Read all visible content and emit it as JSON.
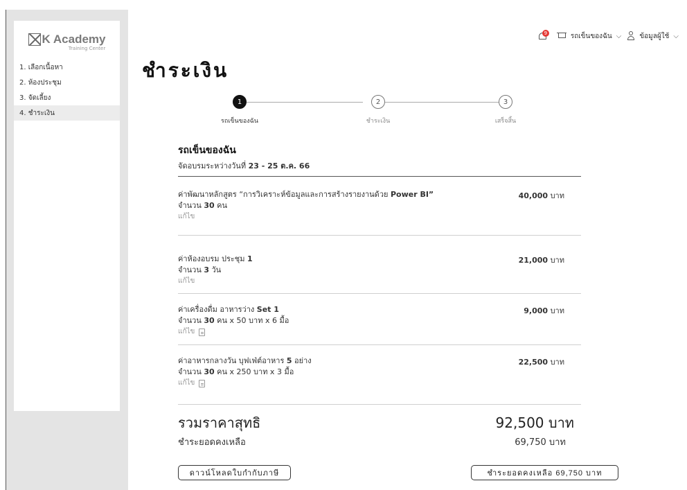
{
  "brand": {
    "name": "K Academy",
    "subtitle": "Training Center"
  },
  "sidebar": {
    "items": [
      {
        "label": "1. เลือกเนื้อหา"
      },
      {
        "label": "2. ห้องประชุม"
      },
      {
        "label": "3. จัดเลี้ยง"
      },
      {
        "label": "4. ชำระเงิน"
      }
    ],
    "active_index": 3
  },
  "header": {
    "notification_count": "9",
    "cart_label": "รถเข็นของฉัน",
    "user_label": "ข้อมูลผู้ใช้"
  },
  "page": {
    "title": "ชำระเงิน"
  },
  "stepper": {
    "steps": [
      {
        "number": "1",
        "label": "รถเข็นของฉัน"
      },
      {
        "number": "2",
        "label": "ชำระเงิน"
      },
      {
        "number": "3",
        "label": "เสร็จสิ้น"
      }
    ],
    "active_index": 0
  },
  "cart": {
    "title": "รถเข็นของฉัน",
    "dates_prefix": "จัดอบรมระหว่างวันที่",
    "dates_value": "23 - 25 ต.ค. 66",
    "edit_label": "แก้ไข",
    "items": [
      {
        "name_prefix": "ค่าพัฒนาหลักสูตร “การวิเคราะห์ข้อมูลและการสร้างรายงานด้วย",
        "name_bold": "Power BI”",
        "qty_prefix": "จำนวน",
        "qty_bold": "30",
        "qty_suffix": "คน",
        "price": "40,000",
        "unit": "บาท"
      },
      {
        "name_prefix": "ค่าห้องอบรม ประชุม",
        "name_bold": "1",
        "qty_prefix": "จำนวน",
        "qty_bold": "3",
        "qty_suffix": "วัน",
        "price": "21,000",
        "unit": "บาท"
      },
      {
        "name_prefix": "ค่าเครื่องดื่ม อาหารว่าง",
        "name_bold": "Set 1",
        "qty_prefix": "จำนวน",
        "qty_bold": "30",
        "qty_suffix": "คน x 50 บาท x 6 มื้อ",
        "price": "9,000",
        "unit": "บาท"
      },
      {
        "name_prefix": "ค่าอาหารกลางวัน บุฟเฟ่ต์อาหาร",
        "name_bold": "5",
        "name_suffix": "อย่าง",
        "qty_prefix": "จำนวน",
        "qty_bold": "30",
        "qty_suffix": "คน x 250 บาท x 3 มื้อ",
        "price": "22,500",
        "unit": "บาท"
      }
    ]
  },
  "summary": {
    "total_label": "รวมราคาสุทธิ",
    "total_value": "92,500 บาท",
    "balance_label": "ชำระยอดคงเหลือ",
    "balance_value": "69,750 บาท"
  },
  "actions": {
    "download_label": "ดาวน์โหลดใบกำกับภาษี",
    "pay_label": "ชำระยอดคงเหลือ 69,750 บาท"
  }
}
